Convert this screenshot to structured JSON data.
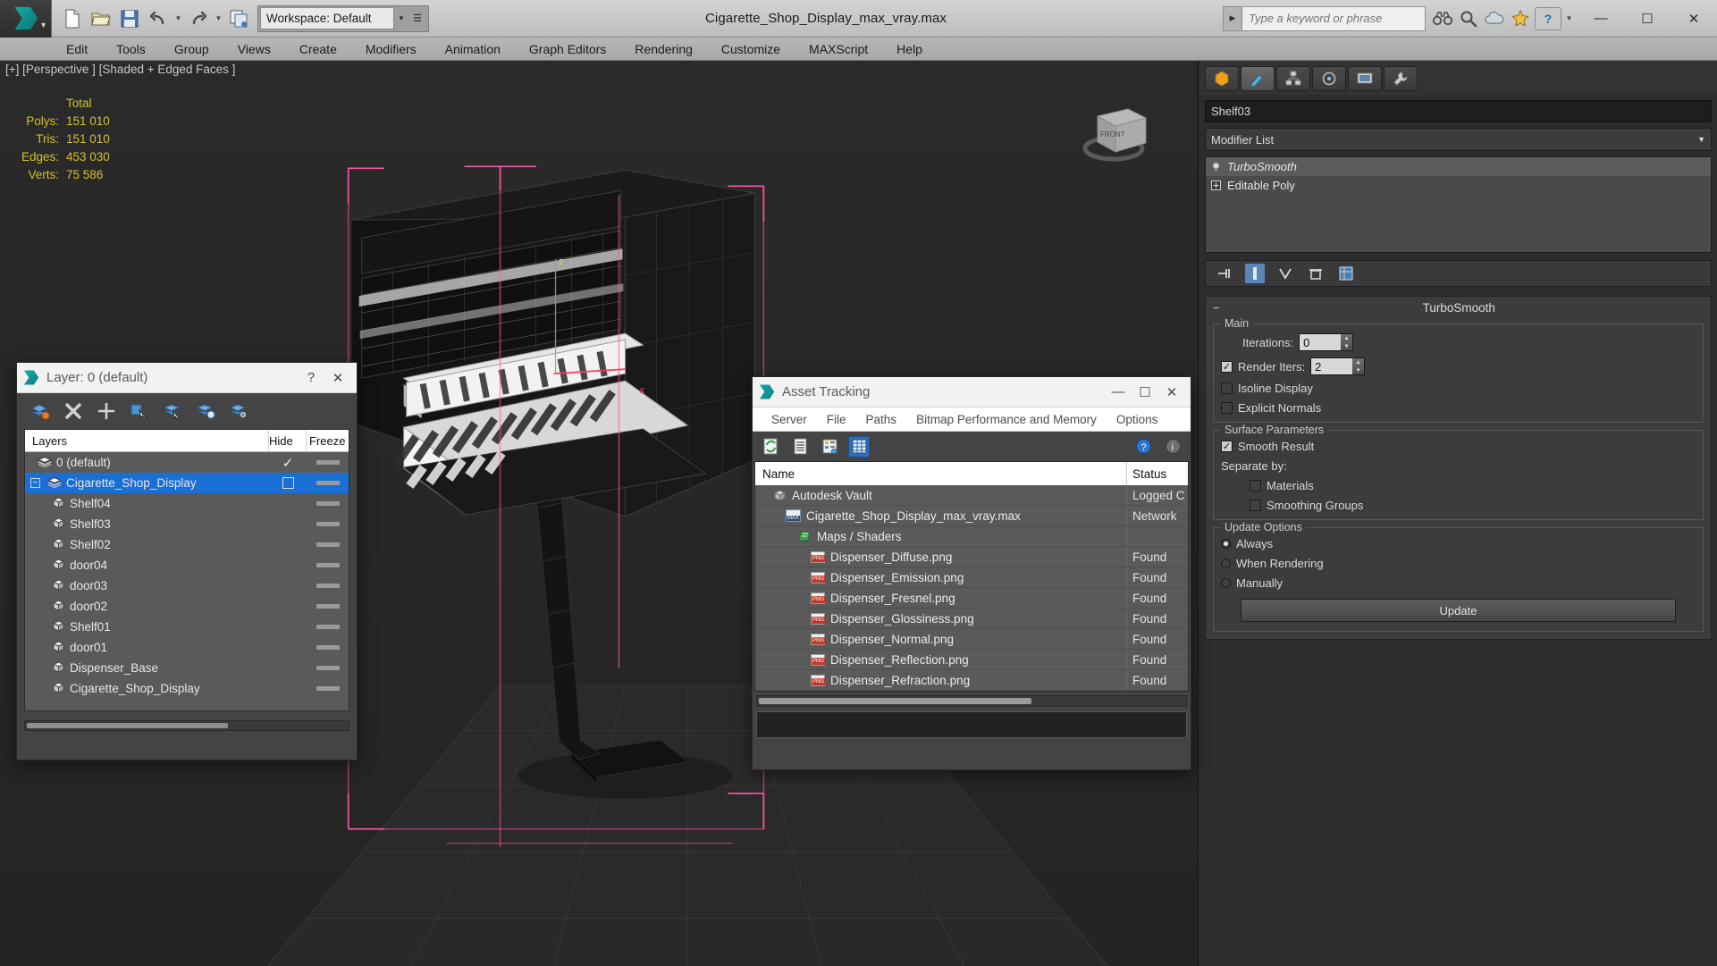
{
  "titlebar": {
    "document_title": "Cigarette_Shop_Display_max_vray.max",
    "workspace_label": "Workspace: Default",
    "search_placeholder": "Type a keyword or phrase",
    "quick_access": [
      {
        "name": "new-file-icon",
        "label": "New"
      },
      {
        "name": "open-file-icon",
        "label": "Open"
      },
      {
        "name": "save-file-icon",
        "label": "Save"
      },
      {
        "name": "undo-icon",
        "label": "Undo"
      },
      {
        "name": "redo-icon",
        "label": "Redo"
      },
      {
        "name": "project-folder-icon",
        "label": "Set Project Folder"
      }
    ],
    "window_buttons": {
      "minimize": "—",
      "maximize": "☐",
      "close": "✕"
    }
  },
  "menubar": {
    "items": [
      "Edit",
      "Tools",
      "Group",
      "Views",
      "Create",
      "Modifiers",
      "Animation",
      "Graph Editors",
      "Rendering",
      "Customize",
      "MAXScript",
      "Help"
    ]
  },
  "viewport": {
    "label": "[+] [Perspective ] [Shaded + Edged Faces ]",
    "stats": {
      "header": "Total",
      "rows": [
        {
          "label": "Polys:",
          "value": "151 010"
        },
        {
          "label": "Tris:",
          "value": "151 010"
        },
        {
          "label": "Edges:",
          "value": "453 030"
        },
        {
          "label": "Verts:",
          "value": "75 586"
        }
      ]
    },
    "viewcube_label": "FRONT"
  },
  "command_panel": {
    "tabs": [
      {
        "name": "create-tab",
        "label": "Create"
      },
      {
        "name": "modify-tab",
        "label": "Modify"
      },
      {
        "name": "hierarchy-tab",
        "label": "Hierarchy"
      },
      {
        "name": "motion-tab",
        "label": "Motion"
      },
      {
        "name": "display-tab",
        "label": "Display"
      },
      {
        "name": "utilities-tab",
        "label": "Utilities"
      }
    ],
    "object_name": "Shelf03",
    "modifier_list_label": "Modifier List",
    "modifier_stack": [
      {
        "label": "TurboSmooth",
        "selected": true
      },
      {
        "label": "Editable Poly",
        "selected": false
      }
    ],
    "rollout": {
      "title": "TurboSmooth",
      "collapse_glyph": "−",
      "main_group_label": "Main",
      "iterations_label": "Iterations:",
      "iterations_value": "0",
      "render_iters_label": "Render Iters:",
      "render_iters_value": "2",
      "render_iters_checked": true,
      "isoline_label": "Isoline Display",
      "isoline_checked": false,
      "explicit_normals_label": "Explicit Normals",
      "explicit_normals_checked": false,
      "surface_params_label": "Surface Parameters",
      "smooth_result_label": "Smooth Result",
      "smooth_result_checked": true,
      "separate_by_label": "Separate by:",
      "materials_label": "Materials",
      "materials_checked": false,
      "smoothing_groups_label": "Smoothing Groups",
      "smoothing_groups_checked": false,
      "update_options_label": "Update Options",
      "update_modes": [
        {
          "label": "Always",
          "selected": true
        },
        {
          "label": "When Rendering",
          "selected": false
        },
        {
          "label": "Manually",
          "selected": false
        }
      ],
      "update_button_label": "Update"
    }
  },
  "layer_dialog": {
    "title": "Layer: 0 (default)",
    "help_glyph": "?",
    "close_glyph": "✕",
    "toolbar": [
      {
        "name": "new-layer-icon",
        "label": "Create New Layer"
      },
      {
        "name": "delete-layer-icon",
        "label": "Delete Highlighted Empty Layers"
      },
      {
        "name": "add-selection-icon",
        "label": "Add Selected Objects to Highlighted Layer"
      },
      {
        "name": "select-objects-icon",
        "label": "Select Objects in Highlighted Layers"
      },
      {
        "name": "highlight-selected-icon",
        "label": "Highlight Selected Objects Layers"
      },
      {
        "name": "set-current-icon",
        "label": "Set Highlighted Layer to Current"
      },
      {
        "name": "layer-settings-icon",
        "label": "Layer Settings"
      }
    ],
    "columns": [
      "Layers",
      "Hide",
      "Freeze"
    ],
    "rows": [
      {
        "name": "0 (default)",
        "indent": 1,
        "type": "layer",
        "current": true,
        "selected": false,
        "expander": false
      },
      {
        "name": "Cigarette_Shop_Display",
        "indent": 0,
        "type": "layer",
        "current": false,
        "selected": true,
        "expander": true,
        "expander_glyph": "−"
      },
      {
        "name": "Shelf04",
        "indent": 2,
        "type": "object",
        "selected": false
      },
      {
        "name": "Shelf03",
        "indent": 2,
        "type": "object",
        "selected": false
      },
      {
        "name": "Shelf02",
        "indent": 2,
        "type": "object",
        "selected": false
      },
      {
        "name": "door04",
        "indent": 2,
        "type": "object",
        "selected": false
      },
      {
        "name": "door03",
        "indent": 2,
        "type": "object",
        "selected": false
      },
      {
        "name": "door02",
        "indent": 2,
        "type": "object",
        "selected": false
      },
      {
        "name": "Shelf01",
        "indent": 2,
        "type": "object",
        "selected": false
      },
      {
        "name": "door01",
        "indent": 2,
        "type": "object",
        "selected": false
      },
      {
        "name": "Dispenser_Base",
        "indent": 2,
        "type": "object",
        "selected": false
      },
      {
        "name": "Cigarette_Shop_Display",
        "indent": 2,
        "type": "object",
        "selected": false
      }
    ]
  },
  "asset_dialog": {
    "title": "Asset Tracking",
    "window_buttons": {
      "minimize": "—",
      "maximize": "☐",
      "close": "✕"
    },
    "menu": [
      "Server",
      "File",
      "Paths",
      "Bitmap Performance and Memory",
      "Options"
    ],
    "toolbar": [
      {
        "name": "refresh-icon",
        "label": "Refresh"
      },
      {
        "name": "list-view-icon",
        "label": "List View"
      },
      {
        "name": "details-view-icon",
        "label": "Details"
      },
      {
        "name": "table-view-icon",
        "label": "Table View",
        "active": true
      }
    ],
    "toolbar_right": [
      {
        "name": "help-icon",
        "label": "Help"
      },
      {
        "name": "about-icon",
        "label": "About"
      }
    ],
    "columns": [
      "Name",
      "Status"
    ],
    "rows": [
      {
        "name": "Autodesk Vault",
        "status": "Logged C",
        "indent": 1,
        "icon": "vault-icon"
      },
      {
        "name": "Cigarette_Shop_Display_max_vray.max",
        "status": "Network",
        "indent": 2,
        "icon": "max-file-icon"
      },
      {
        "name": "Maps / Shaders",
        "status": "",
        "indent": 3,
        "icon": "maps-shaders-icon"
      },
      {
        "name": "Dispenser_Diffuse.png",
        "status": "Found",
        "indent": 4,
        "icon": "png-file-icon"
      },
      {
        "name": "Dispenser_Emission.png",
        "status": "Found",
        "indent": 4,
        "icon": "png-file-icon"
      },
      {
        "name": "Dispenser_Fresnel.png",
        "status": "Found",
        "indent": 4,
        "icon": "png-file-icon"
      },
      {
        "name": "Dispenser_Glossiness.png",
        "status": "Found",
        "indent": 4,
        "icon": "png-file-icon"
      },
      {
        "name": "Dispenser_Normal.png",
        "status": "Found",
        "indent": 4,
        "icon": "png-file-icon"
      },
      {
        "name": "Dispenser_Reflection.png",
        "status": "Found",
        "indent": 4,
        "icon": "png-file-icon"
      },
      {
        "name": "Dispenser_Refraction.png",
        "status": "Found",
        "indent": 4,
        "icon": "png-file-icon"
      }
    ]
  },
  "colors": {
    "accent_blue": "#1a6fd4",
    "stats_yellow": "#d6c02c",
    "viewport_bg": "#262626",
    "gizmo_pink": "#ff55aa"
  }
}
